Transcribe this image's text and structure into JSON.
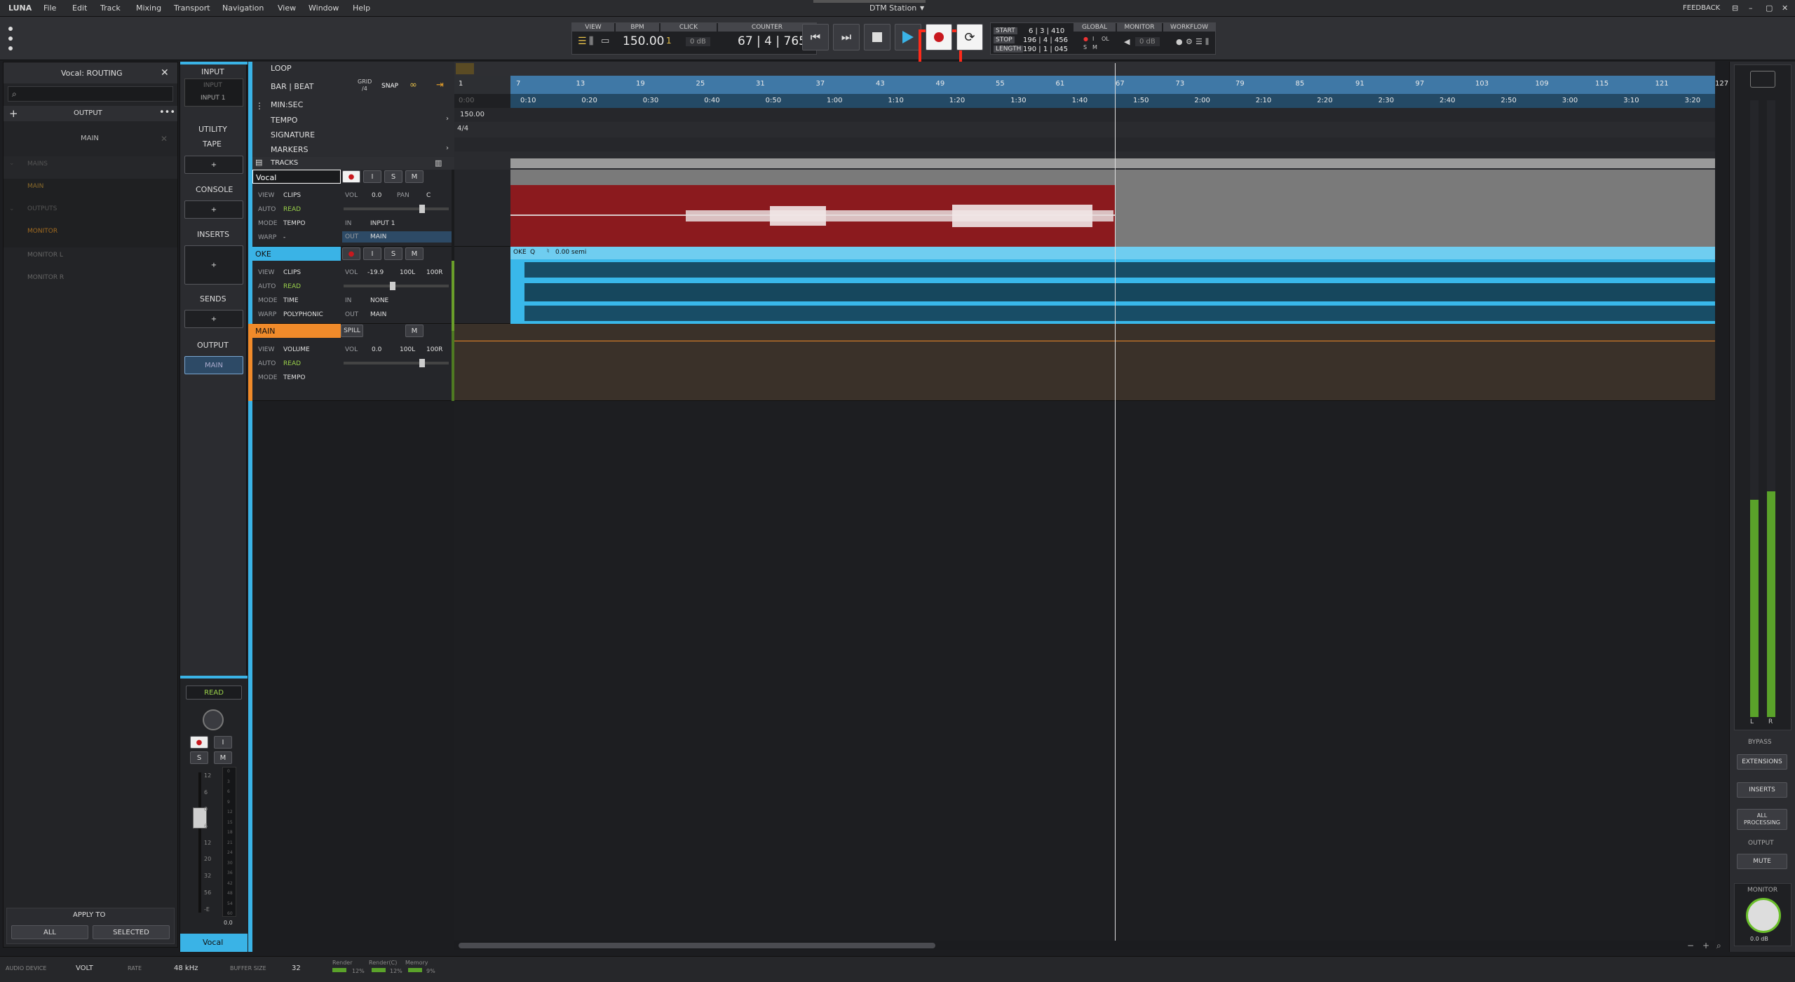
{
  "menubar": {
    "app": "LUNA",
    "items": [
      "File",
      "Edit",
      "Track",
      "Mixing",
      "Transport",
      "Navigation",
      "View",
      "Window",
      "Help"
    ],
    "station": "DTM Station",
    "feedback": "FEEDBACK"
  },
  "toolbar": {
    "view_label": "VIEW",
    "bpm_label": "BPM",
    "bpm_value": "150.00",
    "click_label": "CLICK",
    "click_db": "0 dB",
    "click_bar": "1",
    "counter_label": "COUNTER",
    "counter_value": "67 | 4 | 765",
    "start_label": "START",
    "stop_label": "STOP",
    "length_label": "LENGTH",
    "start_value": "6 | 3 | 410",
    "stop_value": "196 | 4 | 456",
    "length_value": "190 | 1 | 045",
    "global_label": "GLOBAL",
    "monitor_label": "MONITOR",
    "monitor_db": "0 dB",
    "workflow_label": "WORKFLOW",
    "global_i": "I",
    "global_ol": "OL",
    "global_s": "S",
    "global_m": "M"
  },
  "routing": {
    "title": "Vocal: ROUTING",
    "search_placeholder": "",
    "output_label": "OUTPUT",
    "main_label": "MAIN",
    "tree": [
      {
        "label": "MAINS",
        "type": "header"
      },
      {
        "label": "MAIN",
        "type": "item-active"
      },
      {
        "label": "OUTPUTS",
        "type": "header"
      },
      {
        "label": "MONITOR",
        "type": "item-orange"
      },
      {
        "label": "MONITOR L",
        "type": "item"
      },
      {
        "label": "MONITOR R",
        "type": "item"
      }
    ],
    "apply_label": "APPLY TO",
    "apply_all": "ALL",
    "apply_selected": "SELECTED"
  },
  "strip": {
    "input": "INPUT",
    "input_btn": "INPUT",
    "input_val": "INPUT 1",
    "utility": "UTILITY",
    "tape": "TAPE",
    "console": "CONSOLE",
    "inserts": "INSERTS",
    "sends": "SENDS",
    "output": "OUTPUT",
    "output_val": "MAIN",
    "read": "READ",
    "name": "Vocal",
    "plus": "+",
    "meter_scale": [
      "0",
      "3",
      "6",
      "9",
      "12",
      "15",
      "18",
      "21",
      "24",
      "30",
      "36",
      "42",
      "48",
      "54",
      "60"
    ],
    "fader_scale": [
      "12",
      "6",
      "0",
      "6",
      "12",
      "20",
      "32",
      "56",
      "-E"
    ],
    "fader_value": "0.0",
    "rec": "●",
    "input_btn_i": "I",
    "solo": "S",
    "mute": "M"
  },
  "timeline": {
    "loop": "LOOP",
    "barbeat": "BAR | BEAT",
    "grid": "GRID",
    "grid_val": "/4",
    "snap": "SNAP",
    "minsec": "MIN:SEC",
    "tempo": "TEMPO",
    "signature": "SIGNATURE",
    "markers": "MARKERS",
    "tracks": "TRACKS",
    "tempo_value": "150.00",
    "sig_value": "4/4",
    "minsec_start": "0:00",
    "bar_ticks": [
      "1",
      "7",
      "13",
      "19",
      "25",
      "31",
      "37",
      "43",
      "49",
      "55",
      "61",
      "67",
      "73",
      "79",
      "85",
      "91",
      "97",
      "103",
      "109",
      "115",
      "121",
      "127"
    ],
    "time_ticks": [
      "0:10",
      "0:20",
      "0:30",
      "0:40",
      "0:50",
      "1:00",
      "1:10",
      "1:20",
      "1:30",
      "1:40",
      "1:50",
      "2:00",
      "2:10",
      "2:20",
      "2:30",
      "2:40",
      "2:50",
      "3:00",
      "3:10",
      "3:20"
    ]
  },
  "tracks": [
    {
      "name": "Vocal",
      "view": "CLIPS",
      "auto": "READ",
      "mode": "TEMPO",
      "warp": "-",
      "vol": "0.0",
      "pan_label": "PAN",
      "pan": "C",
      "in": "INPUT 1",
      "out": "MAIN",
      "color": "#8b1a1e"
    },
    {
      "name": "OKE",
      "view": "CLIPS",
      "auto": "READ",
      "mode": "TIME",
      "warp": "POLYPHONIC",
      "vol": "-19.9",
      "pan_l": "100L",
      "pan_r": "100R",
      "in": "NONE",
      "out": "MAIN",
      "color": "#39b8ea",
      "clip_label": "OKE",
      "clip_q": "Q",
      "clip_semi": "0.00 semi"
    },
    {
      "name": "MAIN",
      "view": "VOLUME",
      "auto": "READ",
      "mode": "TEMPO",
      "vol": "0.0",
      "pan_l": "100L",
      "pan_r": "100R",
      "spill": "SPILL",
      "color": "#f08a2a"
    }
  ],
  "track_labels": {
    "view": "VIEW",
    "auto": "AUTO",
    "mode": "MODE",
    "warp": "WARP",
    "vol": "VOL",
    "in": "IN",
    "out": "OUT",
    "rec": "●",
    "i": "I",
    "s": "S",
    "m": "M"
  },
  "right": {
    "bypass": "BYPASS",
    "extensions": "EXTENSIONS",
    "inserts": "INSERTS",
    "all_processing_1": "ALL",
    "all_processing_2": "PROCESSING",
    "output": "OUTPUT",
    "mute": "MUTE",
    "monitor": "MONITOR",
    "monitor_val": "0.0 dB",
    "l": "L",
    "r": "R"
  },
  "statusbar": {
    "audio_device_label": "AUDIO DEVICE",
    "audio_device": "VOLT",
    "rate_label": "RATE",
    "rate": "48 kHz",
    "buffer_label": "BUFFER SIZE",
    "buffer": "32",
    "render_label": "Render",
    "render_pct": "12%",
    "renderc_label": "Render(C)",
    "renderc_pct": "12%",
    "memory_label": "Memory",
    "memory_pct": "9%"
  },
  "colors": {
    "accent_blue": "#3ab3e6",
    "vocal_red": "#8b1a1e",
    "main_orange": "#f08a2a",
    "record_highlight": "#ff2a1a"
  }
}
